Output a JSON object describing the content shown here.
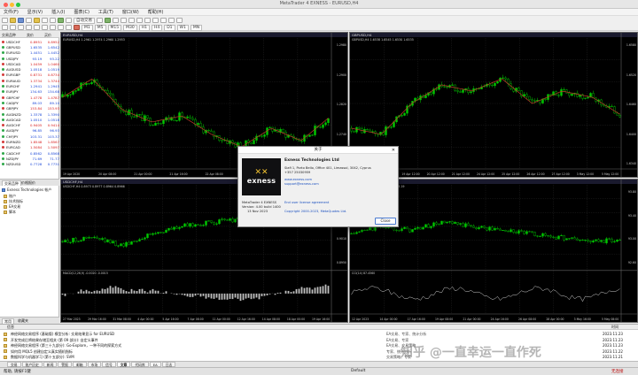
{
  "window": {
    "title": "MetaTrader 4 EXNESS - EURUSD,H4"
  },
  "menu": [
    "文件(F)",
    "显示(V)",
    "插入(I)",
    "图表(C)",
    "工具(T)",
    "窗口(W)",
    "帮助(H)"
  ],
  "toolbar": {
    "auto_trading": "自动交易",
    "timeframes": [
      "M1",
      "M5",
      "M15",
      "M30",
      "H1",
      "H4",
      "D1",
      "W1",
      "MN"
    ]
  },
  "market_watch": {
    "title": "市场报价",
    "columns": [
      "交易品种",
      "卖价",
      "买价"
    ],
    "rows": [
      {
        "sym": "USDCHF",
        "bid": "0.8951",
        "ask": "0.8952",
        "dir": "dn"
      },
      {
        "sym": "GBPUSD",
        "bid": "1.6535",
        "ask": "1.6542",
        "dir": "up"
      },
      {
        "sym": "EURUSD",
        "bid": "1.4451",
        "ask": "1.4452",
        "dir": "up"
      },
      {
        "sym": "USDJPY",
        "bid": "93.19",
        "ask": "93.22",
        "dir": "up"
      },
      {
        "sym": "USDCAD",
        "bid": "1.0459",
        "1ask": "",
        "ask": "1.0460",
        "dir": "dn"
      },
      {
        "sym": "AUDUSD",
        "bid": "1.0518",
        "ask": "1.0519",
        "dir": "up"
      },
      {
        "sym": "EURGBP",
        "bid": "0.8731",
        "ask": "0.8734",
        "dir": "dn"
      },
      {
        "sym": "EURAUD",
        "bid": "1.3734",
        "ask": "1.3744",
        "dir": "dn"
      },
      {
        "sym": "EURCHF",
        "bid": "1.2941",
        "ask": "1.2945",
        "dir": "up"
      },
      {
        "sym": "EURJPY",
        "bid": "134.63",
        "ask": "134.68",
        "dir": "up"
      },
      {
        "sym": "GBPCHF",
        "bid": "1.4778",
        "ask": "1.4787",
        "dir": "dn"
      },
      {
        "sym": "CADJPY",
        "bid": "89.03",
        "ask": "89.10",
        "dir": "up"
      },
      {
        "sym": "GBPJPY",
        "bid": "153.84",
        "ask": "153.93",
        "dir": "dn"
      },
      {
        "sym": "AUDNZD",
        "bid": "1.3378",
        "ask": "1.3390",
        "dir": "up"
      },
      {
        "sym": "AUDCAD",
        "bid": "1.0510",
        "ask": "1.0518",
        "dir": "up"
      },
      {
        "sym": "AUDCHF",
        "bid": "0.9405",
        "ask": "0.9414",
        "dir": "dn"
      },
      {
        "sym": "AUDJPY",
        "bid": "96.85",
        "ask": "96.93",
        "dir": "up"
      },
      {
        "sym": "CHFJPY",
        "bid": "103.31",
        "ask": "103.37",
        "dir": "up"
      },
      {
        "sym": "EURNZD",
        "bid": "1.8548",
        "ask": "1.8567",
        "dir": "dn"
      },
      {
        "sym": "EURCAD",
        "bid": "1.5084",
        "ask": "1.5097",
        "dir": "dn"
      },
      {
        "sym": "CADCHF",
        "bid": "0.8562",
        "ask": "0.8568",
        "dir": "up"
      },
      {
        "sym": "NZDJPY",
        "bid": "71.69",
        "ask": "71.77",
        "dir": "up"
      },
      {
        "sym": "NZDUSD",
        "bid": "0.7728",
        "ask": "0.7731",
        "dir": "up"
      }
    ],
    "tabs": [
      "交易品种",
      "价格报价"
    ]
  },
  "navigator": {
    "title": "Exness Technologies 帐户",
    "items": [
      "账户",
      "技术指标",
      "EA交易",
      "脚本"
    ],
    "tabs": [
      "常用",
      "收藏夹"
    ]
  },
  "charts": [
    {
      "title": "EURUSD,H4",
      "head": "EURUSD,H4  1.2961 1.2974 1.2960 1.2953",
      "xlabels": [
        "19 Apr 2020",
        "20 Apr 08:00",
        "21 Apr 00:00",
        "21 Apr 16:00",
        "22 Apr 08:00",
        "23 Apr 00:00",
        "23 Apr 16:00",
        "24 Apr 08:00"
      ],
      "ylabels": [
        "1.2980",
        "1.2900",
        "1.2820",
        "1.2740",
        "1.2660"
      ]
    },
    {
      "title": "GBPUSD,H4",
      "head": "GBPUSD,H4  1.6538 1.6545 1.6530 1.6535",
      "xlabels": [
        "17 Apr 2023",
        "18 Apr 12:00",
        "19 Apr 12:00",
        "20 Apr 12:00",
        "21 Apr 12:00",
        "24 Apr 12:00",
        "25 Apr 12:00",
        "26 Apr 12:00",
        "27 Apr 12:00",
        "3 May 12:00",
        "5 May 12:00"
      ],
      "ylabels": [
        "1.6580",
        "1.6520",
        "1.6460",
        "1.6400",
        "1.6340"
      ]
    },
    {
      "title": "USDCHF,H4",
      "head": "USDCHF,H4  0.8973 0.8977 0.8964 0.8966",
      "sub": "MACD(12,26,9) -0.0020 -0.0015",
      "xlabels": [
        "27 Mar 2023",
        "29 Mar 16:00",
        "31 Mar 08:00",
        "4 Apr 00:00",
        "5 Apr 16:00",
        "7 Apr 08:00",
        "11 Apr 00:00",
        "12 Apr 16:00",
        "14 Apr 08:00",
        "18 Apr 00:00",
        "19 Apr 16:00"
      ],
      "ylabels": [
        "0.9130",
        "0.9070",
        "0.9010",
        "0.8950"
      ]
    },
    {
      "title": "USDJPY,H4",
      "head": "USDJPY,H4  93.20 93.24 93.15 93.19",
      "sub": "CCI(14) 87.4560",
      "xlabels": [
        "12 Apr 2023",
        "14 Apr 00:00",
        "17 Apr 16:00",
        "19 Apr 08:00",
        "21 Apr 00:00",
        "24 Apr 16:00",
        "26 Apr 08:00",
        "28 Apr 00:00",
        "3 May 16:00",
        "5 May 08:00"
      ],
      "ylabels": [
        "93.80",
        "93.40",
        "93.00",
        "92.60"
      ]
    }
  ],
  "about": {
    "title": "关于",
    "company": "Exness Technologies Ltd",
    "address": "Siafi 1, Porto Bello, Office 401, Limassol, 3042, Cyprus",
    "phone": "+357 25030959",
    "web": "www.exness.com",
    "email": "support@exness.com",
    "eula": "End user license agreement",
    "copyright": "Copyright 2000-2023, MetaQuotes Ltd.",
    "version_lines": [
      "MetaTrader 4 EXNESS",
      "Version: 4.00 build 1400",
      "13 Nov 2023"
    ],
    "logo_word": "exness",
    "close": "Close"
  },
  "terminal": {
    "columns": [
      "时间",
      "信息"
    ],
    "rows": [
      {
        "msg": "神经网络交易程序 (基础版) 模型分析: 交易结果显示 for EURUSD",
        "extra": "EA交易、专家、统计分析",
        "time": "2023.11.23"
      },
      {
        "msg": "开发完成后将结果存储至相关 (第 09 部分): 自定义事件",
        "extra": "EA交易、专家",
        "time": "2023.11.23"
      },
      {
        "msg": "神经网络交易程序 (第三十九部分): Go-Explore，一种不同的探索方式",
        "extra": "EA交易、交易策略",
        "time": "2023.11.23"
      },
      {
        "msg": "如何用 MQL5 创建自定义真实随机指标",
        "extra": "专家、统计分析",
        "time": "2023.11.22"
      },
      {
        "msg": "数据科学与机器学习 (第十五部分): SVM",
        "extra": "交易策略、专家",
        "time": "2023.11.21"
      }
    ],
    "tabs": [
      "交易",
      "账户历史",
      "新闻",
      "警报",
      "邮箱",
      "市场",
      "信号",
      "文章",
      "代码库",
      "EA",
      "日志"
    ],
    "active_tab": "文章"
  },
  "status": {
    "help": "帮助, 请按F1键",
    "profile": "Default",
    "conn": "无连接"
  },
  "colors": {
    "bull": "#00c800",
    "bear": "#000000",
    "wick": "#00c800",
    "grid": "#2c2c2c",
    "ma": "#c0392b"
  },
  "watermark": "知乎 @一直幸运一直作死"
}
